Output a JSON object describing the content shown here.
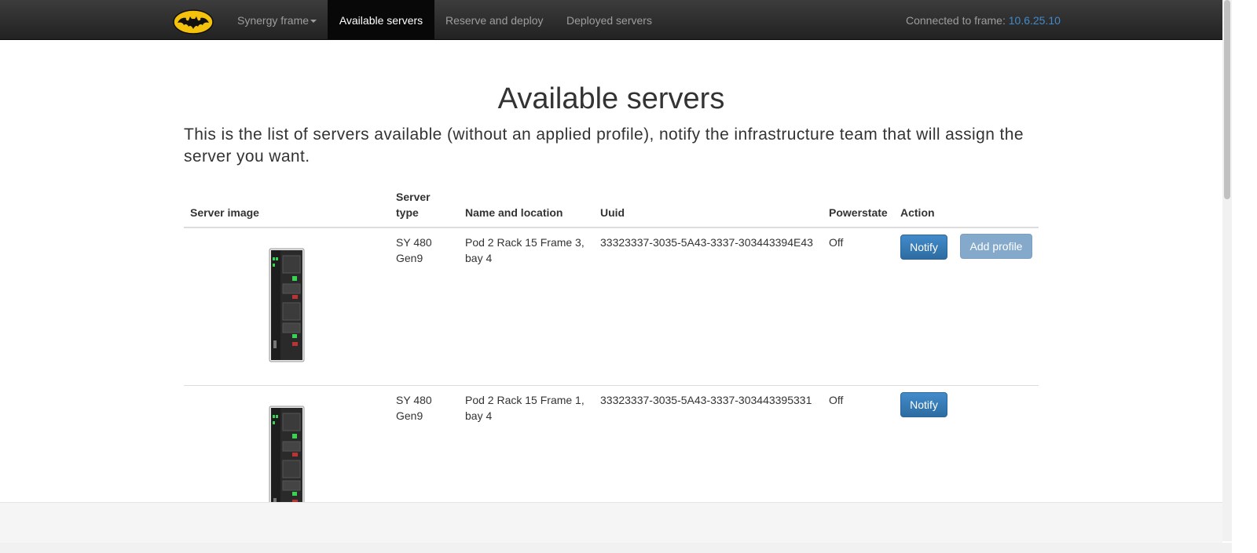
{
  "nav": {
    "dropdown_label": "Synergy frame",
    "items": [
      {
        "label": "Available servers",
        "active": true
      },
      {
        "label": "Reserve and deploy",
        "active": false
      },
      {
        "label": "Deployed servers",
        "active": false
      }
    ],
    "connected_label": "Connected to frame:",
    "frame_ip": "10.6.25.10"
  },
  "page": {
    "title": "Available servers",
    "description": "This is the list of servers available (without an applied profile), notify the infrastructure team that will assign the server you want."
  },
  "table": {
    "headers": {
      "image": "Server image",
      "type_line1": "Server",
      "type_line2": "type",
      "name": "Name and location",
      "uuid": "Uuid",
      "power": "Powerstate",
      "action": "Action"
    },
    "rows": [
      {
        "type_line1": "SY 480",
        "type_line2": "Gen9",
        "name_line1": "Pod 2 Rack 15 Frame 3,",
        "name_line2": "bay 4",
        "uuid": "33323337-3035-5A43-3337-303443394E43",
        "power": "Off",
        "notify_label": "Notify",
        "add_profile_label": "Add profile"
      },
      {
        "type_line1": "SY 480",
        "type_line2": "Gen9",
        "name_line1": "Pod 2 Rack 15 Frame 1,",
        "name_line2": "bay 4",
        "uuid": "33323337-3035-5A43-3337-303443395331",
        "power": "Off",
        "notify_label": "Notify"
      }
    ]
  },
  "colors": {
    "navbar": "#222222",
    "link": "#428bca",
    "primary_button": "#337ab7",
    "logo_yellow": "#f4c20d"
  }
}
